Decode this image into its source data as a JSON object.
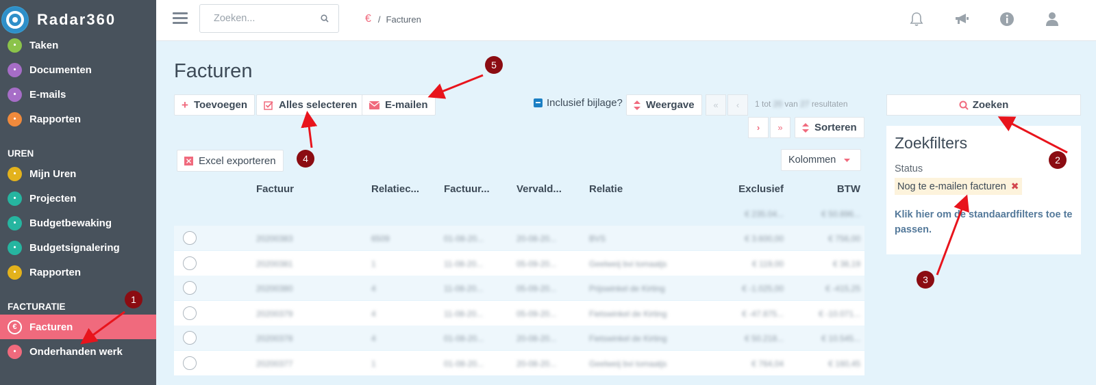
{
  "brand": {
    "name": "Radar360"
  },
  "sidebar": {
    "items_top": [
      {
        "label": "Taken",
        "icon": "lightning-icon",
        "color": "#8bc34a"
      },
      {
        "label": "Documenten",
        "icon": "document-icon",
        "color": "#a66dc7"
      },
      {
        "label": "E-mails",
        "icon": "envelope-icon",
        "color": "#a66dc7"
      },
      {
        "label": "Rapporten",
        "icon": "report-icon",
        "color": "#f08a3c"
      }
    ],
    "section_uren": "UREN",
    "items_uren": [
      {
        "label": "Mijn Uren",
        "icon": "stopwatch-icon",
        "color": "#e3b21c"
      },
      {
        "label": "Projecten",
        "icon": "rocket-icon",
        "color": "#26b5a0"
      },
      {
        "label": "Budgetbewaking",
        "icon": "chat-icon",
        "color": "#26b5a0"
      },
      {
        "label": "Budgetsignalering",
        "icon": "signal-icon",
        "color": "#26b5a0"
      },
      {
        "label": "Rapporten",
        "icon": "report-icon",
        "color": "#e3b21c"
      }
    ],
    "section_facturatie": "FACTURATIE",
    "items_facturatie": [
      {
        "label": "Facturen",
        "icon": "euro-icon",
        "color": "#f06a7d"
      },
      {
        "label": "Onderhanden werk",
        "icon": "bars-icon",
        "color": "#f06a7d"
      }
    ]
  },
  "topbar": {
    "search_placeholder": "Zoeken...",
    "breadcrumb": "Facturen"
  },
  "page": {
    "title": "Facturen"
  },
  "toolbar": {
    "add": "Toevoegen",
    "select_all": "Alles selecteren",
    "email": "E-mailen",
    "include_attachment": "Inclusief bijlage?",
    "view": "Weergave",
    "results_prefix": "1 tot",
    "results_mid": "van",
    "results_suffix": "resultaten",
    "sort": "Sorteren",
    "excel": "Excel exporteren",
    "columns": "Kolommen"
  },
  "table": {
    "headers": [
      "Factuur",
      "Relatiec...",
      "Factuur...",
      "Vervald...",
      "Relatie",
      "Exclusief",
      "BTW"
    ],
    "totals": [
      "€ 235.04...",
      "€ 50.896..."
    ],
    "rows": [
      [
        "20200383",
        "6509",
        "01-08-20...",
        "20-08-20...",
        "BVS",
        "€ 3.600,00",
        "€ 756,00"
      ],
      [
        "20200381",
        "1",
        "11-08-20...",
        "05-09-20...",
        "Geelweij bvi tomaatjs",
        "€ 119,00",
        "€ 38,19"
      ],
      [
        "20200380",
        "4",
        "11-08-20...",
        "05-09-20...",
        "Prijswinkel de Kirting",
        "€ -1.025,00",
        "€ -415,25"
      ],
      [
        "20200379",
        "4",
        "11-08-20...",
        "05-09-20...",
        "Fietswinkel de Kirting",
        "€ -47.875...",
        "€ -10.071..."
      ],
      [
        "20200378",
        "4",
        "01-08-20...",
        "20-08-20...",
        "Fietswinkel de Kirting",
        "€ 50.218...",
        "€ 10.545..."
      ],
      [
        "20200377",
        "1",
        "01-08-20...",
        "20-08-20...",
        "Geelweij bvi tomaatjs",
        "€ 764,04",
        "€ 160,45"
      ]
    ]
  },
  "panel": {
    "search": "Zoeken",
    "title": "Zoekfilters",
    "status_label": "Status",
    "status_value": "Nog te e-mailen facturen",
    "reset_link": "Klik hier om de standaardfilters toe te passen."
  },
  "markers": [
    "1",
    "2",
    "3",
    "4",
    "5"
  ]
}
